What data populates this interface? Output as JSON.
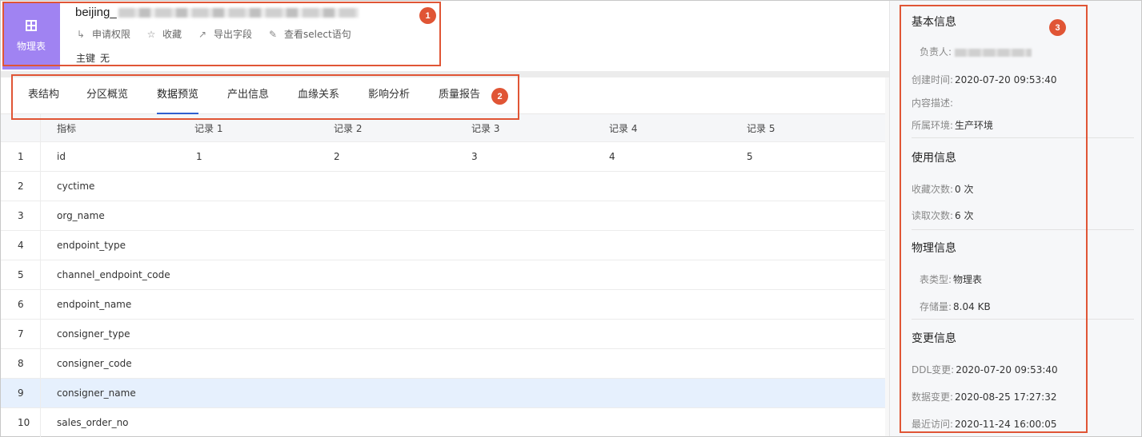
{
  "header": {
    "type_label": "物理表",
    "table_name_prefix": "beijing_",
    "actions": [
      {
        "icon": "apply-permission-icon",
        "label": "申请权限"
      },
      {
        "icon": "star-icon",
        "label": "收藏"
      },
      {
        "icon": "export-icon",
        "label": "导出字段"
      },
      {
        "icon": "edit-icon",
        "label": "查看select语句"
      }
    ],
    "primary_key_label": "主键",
    "primary_key_value": "无"
  },
  "tabs": [
    {
      "label": "表结构",
      "active": false
    },
    {
      "label": "分区概览",
      "active": false
    },
    {
      "label": "数据预览",
      "active": true
    },
    {
      "label": "产出信息",
      "active": false
    },
    {
      "label": "血缘关系",
      "active": false
    },
    {
      "label": "影响分析",
      "active": false
    },
    {
      "label": "质量报告",
      "active": false
    }
  ],
  "grid": {
    "columns": [
      "指标",
      "记录 1",
      "记录 2",
      "记录 3",
      "记录 4",
      "记录 5"
    ],
    "rows": [
      {
        "index": "1",
        "field": "id",
        "r1": "1",
        "r2": "2",
        "r3": "3",
        "r4": "4",
        "r5": "5"
      },
      {
        "index": "2",
        "field": "cyctime",
        "r1": "",
        "r2": "",
        "r3": "",
        "r4": "",
        "r5": ""
      },
      {
        "index": "3",
        "field": "org_name",
        "r1": "",
        "r2": "",
        "r3": "",
        "r4": "",
        "r5": ""
      },
      {
        "index": "4",
        "field": "endpoint_type",
        "r1": "",
        "r2": "",
        "r3": "",
        "r4": "",
        "r5": ""
      },
      {
        "index": "5",
        "field": "channel_endpoint_code",
        "r1": "",
        "r2": "",
        "r3": "",
        "r4": "",
        "r5": ""
      },
      {
        "index": "6",
        "field": "endpoint_name",
        "r1": "",
        "r2": "",
        "r3": "",
        "r4": "",
        "r5": ""
      },
      {
        "index": "7",
        "field": "consigner_type",
        "r1": "",
        "r2": "",
        "r3": "",
        "r4": "",
        "r5": ""
      },
      {
        "index": "8",
        "field": "consigner_code",
        "r1": "",
        "r2": "",
        "r3": "",
        "r4": "",
        "r5": ""
      },
      {
        "index": "9",
        "field": "consigner_name",
        "r1": "",
        "r2": "",
        "r3": "",
        "r4": "",
        "r5": ""
      },
      {
        "index": "10",
        "field": "sales_order_no",
        "r1": "",
        "r2": "",
        "r3": "",
        "r4": "",
        "r5": ""
      }
    ],
    "selected_row_index": "9"
  },
  "sidebar": {
    "basic": {
      "title": "基本信息",
      "owner_label": "负责人:",
      "created_label": "创建时间:",
      "created_value": "2020-07-20 09:53:40",
      "desc_label": "内容描述:",
      "env_label": "所属环境:",
      "env_value": "生产环境"
    },
    "usage": {
      "title": "使用信息",
      "fav_label": "收藏次数:",
      "fav_value": "0 次",
      "read_label": "读取次数:",
      "read_value": "6 次"
    },
    "physical": {
      "title": "物理信息",
      "type_label": "表类型:",
      "type_value": "物理表",
      "storage_label": "存储量:",
      "storage_value": "8.04 KB"
    },
    "change": {
      "title": "变更信息",
      "ddl_label": "DDL变更:",
      "ddl_value": "2020-07-20 09:53:40",
      "data_label": "数据变更:",
      "data_value": "2020-08-25 17:27:32",
      "visit_label": "最近访问:",
      "visit_value": "2020-11-24 16:00:05"
    }
  },
  "annotations": [
    "1",
    "2",
    "3"
  ],
  "colors": {
    "type_tile": "#a083f2",
    "active_tab_underline": "#2f5fcf",
    "annotation": "#e05535",
    "selected_row": "#e6f0fd"
  }
}
